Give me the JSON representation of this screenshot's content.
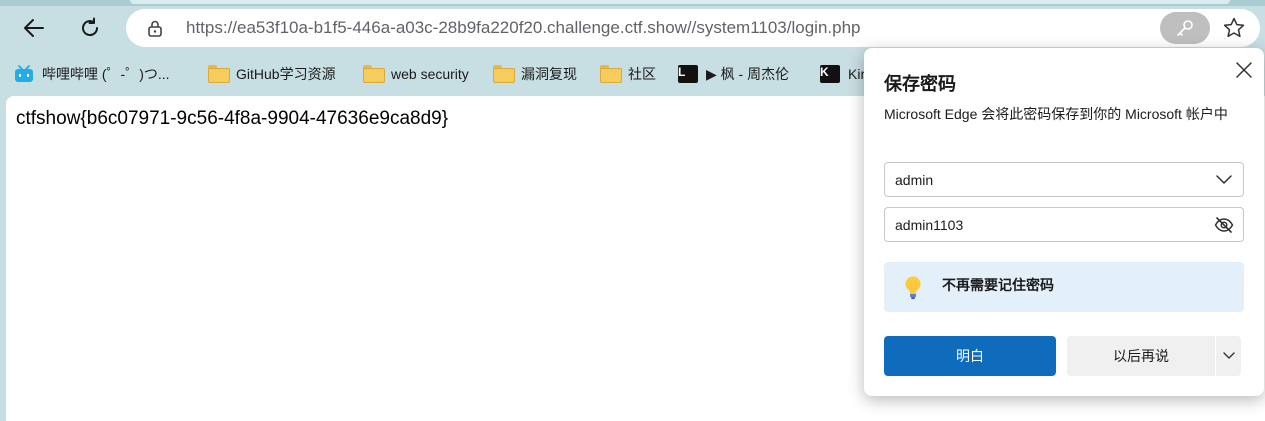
{
  "toolbar": {
    "url": "https://ea53f10a-b1f5-446a-a03c-28b9fa220f20.challenge.ctf.show//system1103/login.php"
  },
  "bookmarks": [
    {
      "label": "哔哩哔哩 (゜-゜)つ...",
      "icon": "bilibili-icon"
    },
    {
      "label": "GitHub学习资源",
      "icon": "folder-icon"
    },
    {
      "label": "web security",
      "icon": "folder-icon"
    },
    {
      "label": "漏洞复现",
      "icon": "folder-icon"
    },
    {
      "label": "社区",
      "icon": "folder-icon"
    },
    {
      "label": "▶ 枫 - 周杰伦",
      "icon": "lyrics-site-icon"
    },
    {
      "label": "Kir",
      "icon": "k-site-icon"
    }
  ],
  "page": {
    "flag_text": "ctfshow{b6c07971-9c56-4f8a-9904-47636e9ca8d9}"
  },
  "password_popup": {
    "title": "保存密码",
    "description": "Microsoft Edge 会将此密码保存到你的 Microsoft 帐户中",
    "username": "admin",
    "password": "admin1103",
    "tip": "不再需要记住密码",
    "primary_button": "明白",
    "secondary_button": "以后再说"
  },
  "colors": {
    "accent": "#0f6cbd",
    "chrome_bg": "#c7dee2",
    "tip_bg": "#e3eff9"
  }
}
